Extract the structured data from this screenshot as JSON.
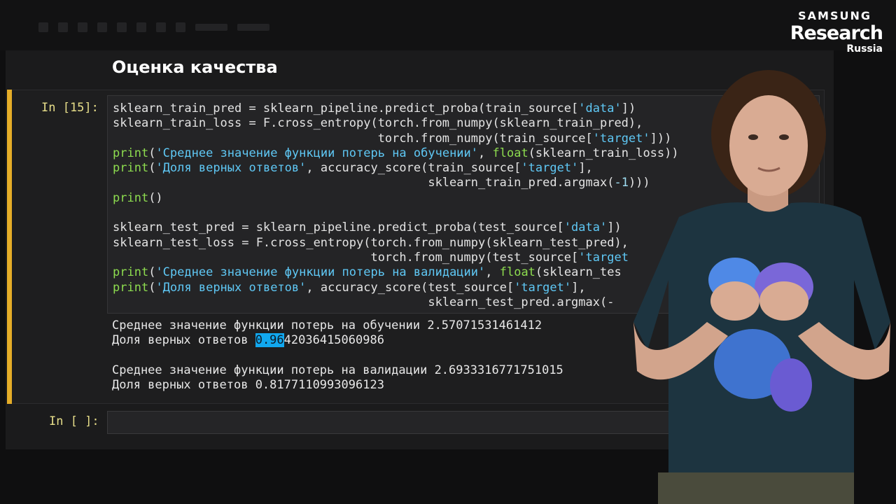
{
  "logo": {
    "line1": "SAMSUNG",
    "line2": "Research",
    "line3": "Russia"
  },
  "notebook": {
    "heading": "Оценка качества",
    "cell_15": {
      "prompt": "In [15]:",
      "code_lines": [
        "sklearn_train_pred = sklearn_pipeline.predict_proba(train_source['data'])",
        "sklearn_train_loss = F.cross_entropy(torch.from_numpy(sklearn_train_pred),",
        "                                     torch.from_numpy(train_source['target']))",
        "print('Среднее значение функции потерь на обучении', float(sklearn_train_loss))",
        "print('Доля верных ответов', accuracy_score(train_source['target'],",
        "                                            sklearn_train_pred.argmax(-1)))",
        "print()",
        "",
        "sklearn_test_pred = sklearn_pipeline.predict_proba(test_source['data'])",
        "sklearn_test_loss = F.cross_entropy(torch.from_numpy(sklearn_test_pred),",
        "                                    torch.from_numpy(test_source['target",
        "print('Среднее значение функции потерь на валидации', float(sklearn_tes",
        "print('Доля верных ответов', accuracy_score(test_source['target'],",
        "                                            sklearn_test_pred.argmax(-"
      ],
      "output": {
        "train_loss_line": "Среднее значение функции потерь на обучении 2.57071531461412",
        "train_acc_prefix": "Доля верных ответов ",
        "train_acc_highlight": "0.96",
        "train_acc_rest": "42036415060986",
        "test_loss_line": "Среднее значение функции потерь на валидации 2.6933316771751015",
        "test_acc_line": "Доля верных ответов 0.8177110993096123"
      }
    },
    "empty_cell": {
      "prompt": "In [ ]:"
    }
  },
  "colors": {
    "accent_bar": "#e5ad28",
    "prompt": "#e8df8a",
    "string": "#5fc8f5",
    "builtin": "#8ddc4f",
    "selection": "#11a8ef"
  }
}
